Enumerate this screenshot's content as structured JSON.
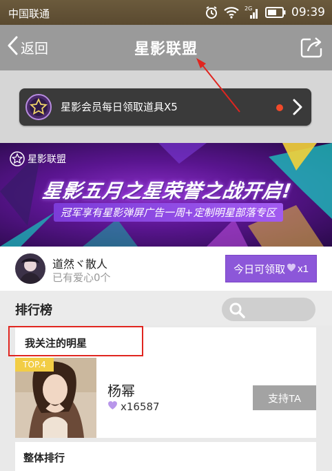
{
  "status_bar": {
    "carrier": "中国联通",
    "network": "2G",
    "time": "09:39",
    "icons": [
      "alarm-icon",
      "wifi-icon",
      "signal-icon",
      "battery-icon"
    ]
  },
  "nav": {
    "back_label": "返回",
    "title": "星影联盟",
    "share_icon": "share-icon"
  },
  "promo": {
    "text": "星影会员每日领取道具X5",
    "has_red_dot": true
  },
  "banner": {
    "brand": "星影联盟",
    "headline": "星影五月之星荣誉之战开启!",
    "subline": "冠军享有星影弹屏广告一周+定制明星部落专区"
  },
  "user": {
    "name": "道然ヾ散人",
    "hearts_text": "已有爱心0个",
    "claim_prefix": "今日可领取",
    "claim_suffix": "x1"
  },
  "ranking": {
    "title": "排行榜",
    "search_icon": "search-icon"
  },
  "followed": {
    "section_label": "我关注的明星",
    "items": [
      {
        "badge": "TOP.4",
        "name": "杨幂",
        "hearts": "x16587",
        "support_label": "支持TA"
      }
    ]
  },
  "overall": {
    "section_label": "整体排行"
  },
  "colors": {
    "status_bar": "#5f4f34",
    "nav_bar": "#9a9a9a",
    "claim_button": "#8c57d9",
    "support_button": "#a3a3a3",
    "badge": "#f2cd45",
    "highlight": "#e0251f"
  }
}
